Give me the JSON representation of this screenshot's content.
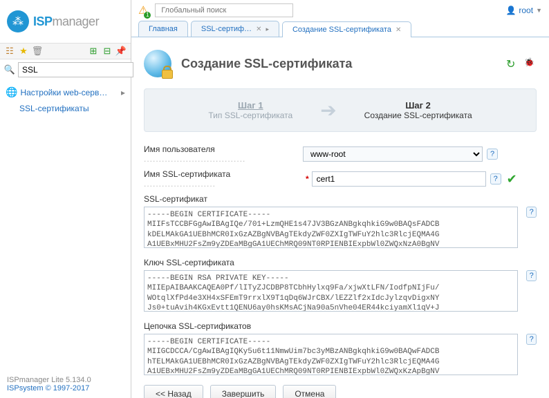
{
  "logo": {
    "brand": "ISP",
    "suffix": "manager"
  },
  "sidebar": {
    "search_value": "SSL",
    "nav_head": "Настройки web-серв…",
    "nav_item": "SSL-сертификаты",
    "footer": {
      "product": "ISPmanager Lite 5.134.0",
      "copyright": "ISPsystem © 1997-2017"
    }
  },
  "topbar": {
    "global_search_placeholder": "Глобальный поиск",
    "warn_count": "1",
    "user": "root"
  },
  "tabs": [
    {
      "label": "Главная",
      "closable": false
    },
    {
      "label": "SSL-сертиф…",
      "closable": true
    },
    {
      "label": "Создание SSL-сертификата",
      "closable": true,
      "active": true
    }
  ],
  "page": {
    "title": "Создание SSL-сертификата"
  },
  "steps": {
    "s1_title": "Шаг 1",
    "s1_sub": "Тип SSL-сертификата",
    "s2_title": "Шаг 2",
    "s2_sub": "Создание SSL-сертификата"
  },
  "form": {
    "username_label": "Имя пользователя",
    "username_value": "www-root",
    "certname_label": "Имя SSL-сертификата",
    "certname_value": "cert1",
    "cert_label": "SSL-сертификат",
    "cert_value": "-----BEGIN CERTIFICATE-----\nMIIFsTCCBFGgAwIBAgIQe/701+LzmQHE1s47JV3BGzANBgkqhkiG9w0BAQsFADCB\nkDELMAkGA1UEBhMCR0IxGzAZBgNVBAgTEkdyZWF0ZXIgTWFuY2hlc3RlcjEQMA4G\nA1UEBxMHU2FsZm9yZDEaMBgGA1UEChMRQ09NT0RPIENBIExpbWl0ZWQxNzA0BgNV\nBAMTLUNPTU9ETyBSU0EgQ29tYWluIFZhbGlkZXRpb24gU2VjdXJlIFNlcnZlcjEj",
    "key_label": "Ключ SSL-сертификата",
    "key_value": "-----BEGIN RSA PRIVATE KEY-----\nMIIEpAIBAAKCAQEA0Pf/lITyZJCDBP8TCbhHylxq9Fa/xjwXtLFN/IodfpNIjFu/\nWOtqlXfPd4e3XH4xSFEmT9rrxlX9T1qDq6WJrCBX/lEZZlf2xIdcJylzqvDigxNY\nJs0+tuAvih4KGxEvtt1QENU6ay0hsKMsACjNa90a5nVhe04ER44kciyamXl1qV+J",
    "chain_label": "Цепочка SSL-сертификатов",
    "chain_value": "-----BEGIN CERTIFICATE-----\nMIIGCDCCA/CgAwIBAgIQKy5u6t11NmwUim7bc3yMBzANBgkqhkiG9w0BAQwFADCB\nhTELMAkGA1UEBhMCR0IxGzAZBgNVBAgTEkdyZWF0ZXIgTWFuY2hlc3RlcjEQMA4G\nA1UEBxMHU2FsZm9yZDEaMBgGA1UEChMRQ09NT0RPIENBIExpbWl0ZWQxKzApBgNV"
  },
  "buttons": {
    "back": "<< Назад",
    "finish": "Завершить",
    "cancel": "Отмена"
  }
}
